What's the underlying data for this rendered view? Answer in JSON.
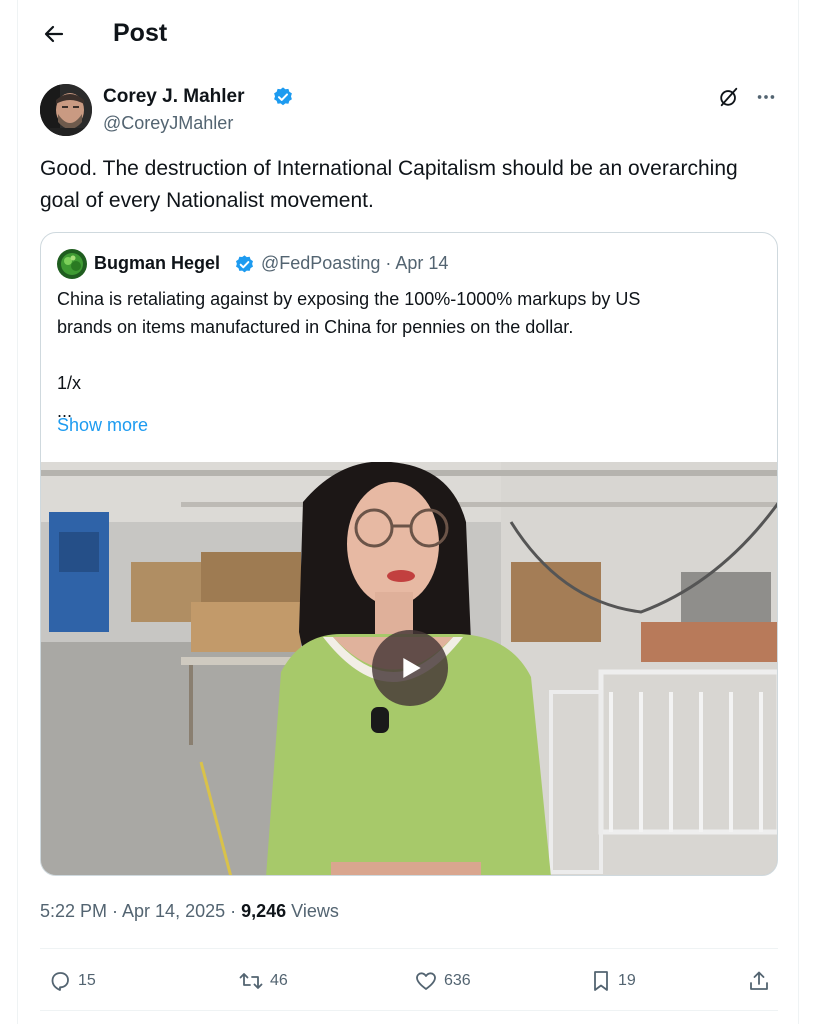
{
  "header": {
    "title": "Post"
  },
  "post": {
    "author": {
      "display_name": "Corey J. Mahler",
      "handle": "@CoreyJMahler",
      "verified": true
    },
    "text": "Good. The destruction of International Capitalism should be an overarching goal of every Nationalist movement.",
    "quote": {
      "author": {
        "display_name": "Bugman Hegel",
        "handle": "@FedPoasting",
        "verified": true
      },
      "meta": "@FedPoasting · Apr 14",
      "text_lines": [
        "China is retaliating against by exposing the 100%-1000% markups by US",
        "brands on items manufactured in China for pennies on the dollar.",
        "",
        "1/x",
        "..."
      ],
      "show_more_label": "Show more",
      "media": {
        "type": "video",
        "play_icon": "play-icon"
      }
    },
    "timestamp": "5:22 PM · Apr 14, 2025 · ",
    "views_count": "9,246",
    "views_label": " Views",
    "metrics": {
      "replies": "15",
      "reposts": "46",
      "likes": "636",
      "bookmarks": "19"
    }
  },
  "colors": {
    "accent": "#1d9bf0",
    "text_primary": "#0f1419",
    "text_secondary": "#536471",
    "border": "#cfd9de"
  }
}
